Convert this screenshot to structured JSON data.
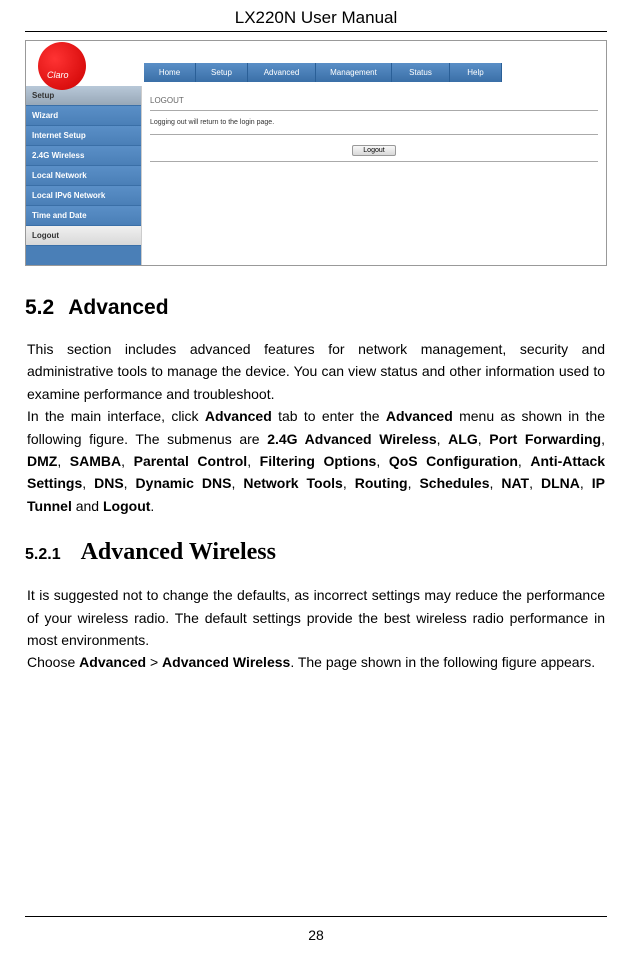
{
  "header": {
    "title": "LX220N User Manual"
  },
  "router": {
    "logo": "Claro",
    "nav": [
      "Home",
      "Setup",
      "Advanced",
      "Management",
      "Status",
      "Help"
    ],
    "sidebar": [
      "Setup",
      "Wizard",
      "Internet Setup",
      "2.4G Wireless",
      "Local Network",
      "Local IPv6 Network",
      "Time and Date",
      "Logout"
    ],
    "content": {
      "subtitle": "LOGOUT",
      "text": "Logging out will return to the login page.",
      "button": "Logout"
    }
  },
  "section": {
    "num": "5.2",
    "title": "Advanced",
    "para1_pre": "This section includes advanced features for network management, security and administrative tools to manage the device. You can view status and other information used to examine performance and troubleshoot.",
    "para2_parts": {
      "t1": "In the main interface, click ",
      "b1": "Advanced",
      "t2": " tab to enter the ",
      "b2": "Advanced",
      "t3": " menu as shown in the following figure. The submenus are ",
      "b3": "2.4G Advanced Wireless",
      "t4": ", ",
      "b4": "ALG",
      "t5": ", ",
      "b5": "Port Forwarding",
      "t6": ", ",
      "b6": "DMZ",
      "t7": ", ",
      "b7": "SAMBA",
      "t8": ", ",
      "b8": "Parental Control",
      "t9": ", ",
      "b9": "Filtering Options",
      "t10": ", ",
      "b10": "QoS Configuration",
      "t11": ", ",
      "b11": "Anti-Attack Settings",
      "t12": ", ",
      "b12": "DNS",
      "t13": ", ",
      "b13": "Dynamic DNS",
      "t14": ", ",
      "b14": "Network Tools",
      "t15": ", ",
      "b15": "Routing",
      "t16": ", ",
      "b16": "Schedules",
      "t17": ", ",
      "b17": "NAT",
      "t18": ", ",
      "b18": "DLNA",
      "t19": ", ",
      "b19": "IP Tunnel",
      "t20": " and ",
      "b20": "Logout",
      "t21": "."
    }
  },
  "subsection": {
    "num": "5.2.1",
    "title": "Advanced Wireless",
    "para1": "It is suggested not to change the defaults, as incorrect settings may reduce the performance of your wireless radio. The default settings provide the best wireless radio performance in most environments.",
    "para2": {
      "t1": "Choose ",
      "b1": "Advanced",
      "t2": " > ",
      "b2": "Advanced Wireless",
      "t3": ". The page shown in the following figure appears."
    }
  },
  "page_number": "28"
}
